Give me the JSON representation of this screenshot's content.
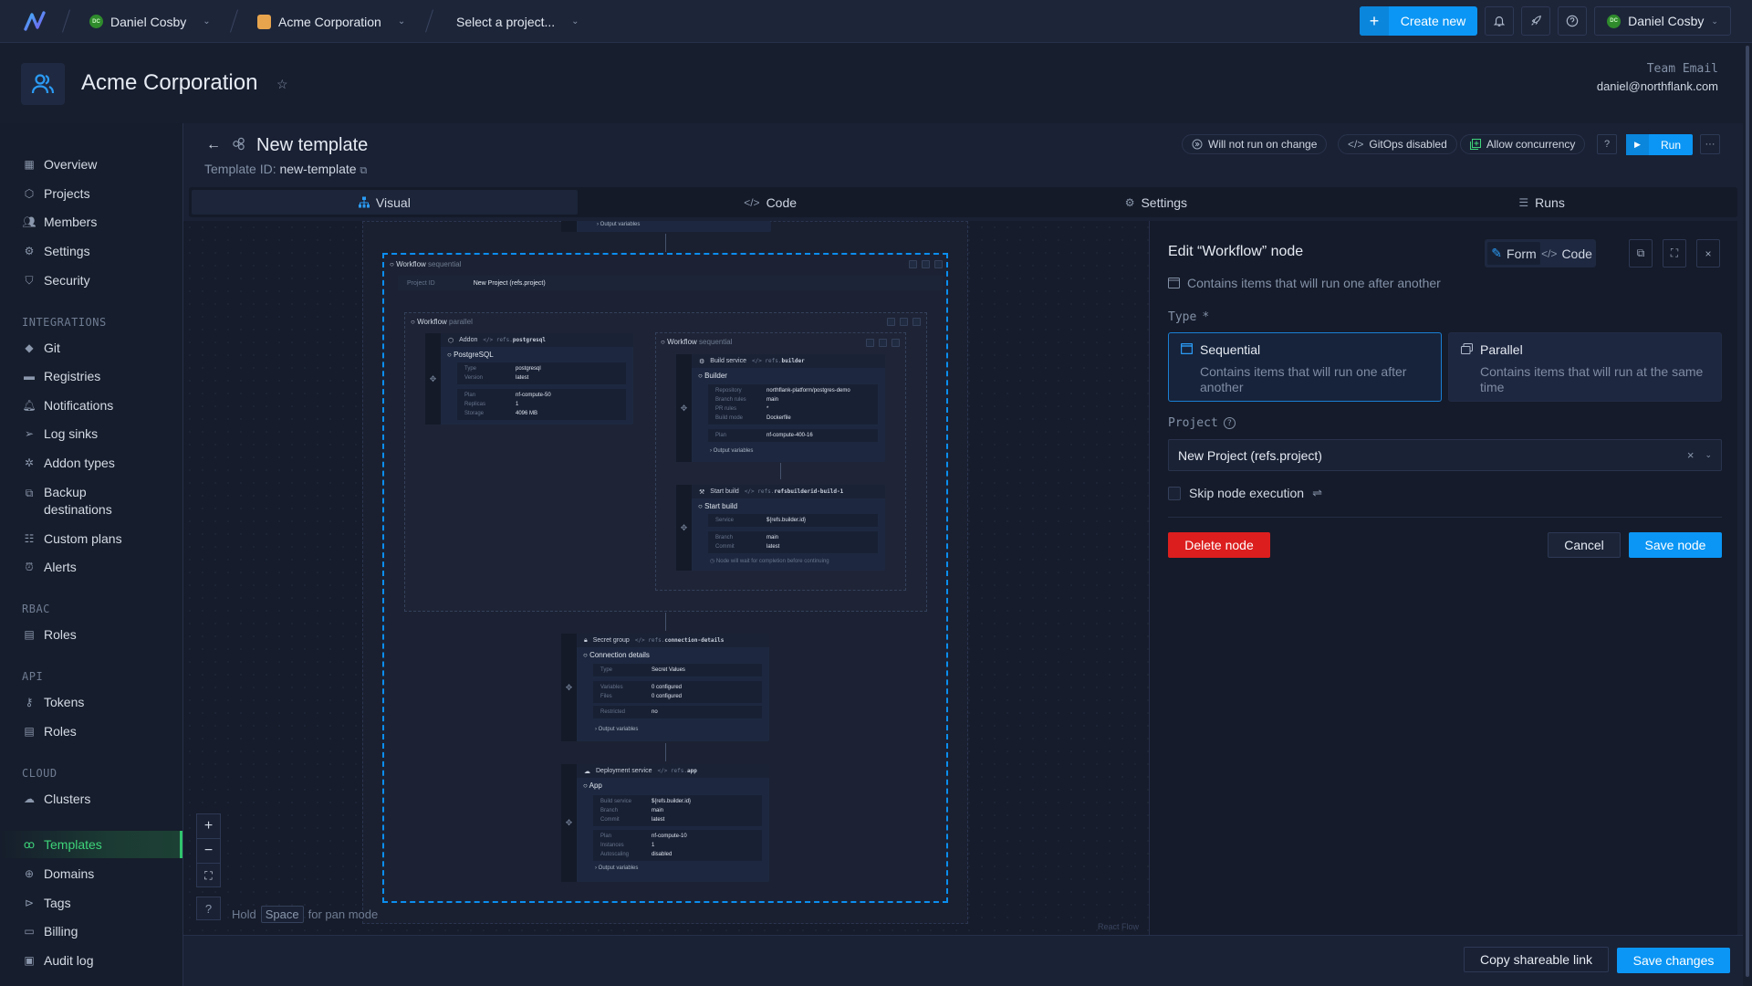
{
  "topbar": {
    "user": {
      "initials": "DC",
      "name": "Daniel Cosby"
    },
    "team": {
      "name": "Acme Corporation"
    },
    "project_select": "Select a project...",
    "create_new": "Create new",
    "account": {
      "initials": "DC",
      "name": "Daniel Cosby"
    },
    "icons": [
      "bell-icon",
      "rocket-icon",
      "help-icon"
    ]
  },
  "org": {
    "title": "Acme Corporation",
    "team_email_label": "Team Email",
    "team_email": "daniel@northflank.com"
  },
  "sidebar": {
    "items": [
      {
        "label": "Overview",
        "icon": "grid-icon"
      },
      {
        "label": "Projects",
        "icon": "cube-icon"
      },
      {
        "label": "Members",
        "icon": "users-icon"
      },
      {
        "label": "Settings",
        "icon": "gear-icon"
      },
      {
        "label": "Security",
        "icon": "shield-icon"
      }
    ],
    "sections": {
      "integrations": "INTEGRATIONS",
      "rbac": "RBAC",
      "api": "API",
      "cloud": "CLOUD"
    },
    "integrations": [
      {
        "label": "Git",
        "icon": "git-icon"
      },
      {
        "label": "Registries",
        "icon": "docker-icon"
      },
      {
        "label": "Notifications",
        "icon": "bell-icon"
      },
      {
        "label": "Log sinks",
        "icon": "send-icon"
      },
      {
        "label": "Addon types",
        "icon": "puzzle-icon"
      },
      {
        "label": "Backup destinations",
        "icon": "copy-icon"
      },
      {
        "label": "Custom plans",
        "icon": "sliders-icon"
      },
      {
        "label": "Alerts",
        "icon": "alarm-icon"
      }
    ],
    "rbac": [
      {
        "label": "Roles",
        "icon": "id-card-icon"
      }
    ],
    "api": [
      {
        "label": "Tokens",
        "icon": "key-icon"
      },
      {
        "label": "Roles",
        "icon": "id-card-icon"
      }
    ],
    "cloud": [
      {
        "label": "Clusters",
        "icon": "cloud-icon"
      }
    ],
    "bottom": [
      {
        "label": "Templates",
        "icon": "template-icon",
        "active": true
      },
      {
        "label": "Domains",
        "icon": "globe-icon"
      },
      {
        "label": "Tags",
        "icon": "tag-icon"
      },
      {
        "label": "Billing",
        "icon": "credit-card-icon"
      },
      {
        "label": "Audit log",
        "icon": "calendar-icon"
      }
    ]
  },
  "template": {
    "title": "New template",
    "id_label": "Template ID:",
    "id_value": "new-template",
    "badges": {
      "run_on_change": "Will not run on change",
      "gitops": "GitOps disabled",
      "concurrency": "Allow concurrency"
    },
    "run": "Run"
  },
  "tabs": [
    {
      "label": "Visual",
      "active": true
    },
    {
      "label": "Code"
    },
    {
      "label": "Settings"
    },
    {
      "label": "Runs"
    }
  ],
  "canvas": {
    "top_output": "Output variables",
    "root": {
      "kind": "Workflow",
      "mode": "sequential",
      "project_label": "Project ID",
      "project_value": "New Project (refs.project)"
    },
    "parallel": {
      "kind": "Workflow",
      "mode": "parallel"
    },
    "addon": {
      "type": "Addon",
      "ref_prefix": "refs.",
      "ref": "postgresql",
      "title": "PostgreSQL",
      "rows1": [
        {
          "k": "Type",
          "v": "postgresql"
        },
        {
          "k": "Version",
          "v": "latest"
        }
      ],
      "rows2": [
        {
          "k": "Plan",
          "v": "nf-compute-50"
        },
        {
          "k": "Replicas",
          "v": "1"
        },
        {
          "k": "Storage",
          "v": "4096 MB"
        }
      ]
    },
    "inner_seq": {
      "kind": "Workflow",
      "mode": "sequential"
    },
    "builder": {
      "type": "Build service",
      "ref_prefix": "refs.",
      "ref": "builder",
      "title": "Builder",
      "rows1": [
        {
          "k": "Repository",
          "v": "northflank-platform/postgres-demo"
        },
        {
          "k": "Branch rules",
          "v": "main"
        },
        {
          "k": "PR rules",
          "v": "*"
        },
        {
          "k": "Build mode",
          "v": "Dockerfile"
        }
      ],
      "rows2": [
        {
          "k": "Plan",
          "v": "nf-compute-400-16"
        }
      ],
      "output": "Output variables"
    },
    "start_build": {
      "type": "Start build",
      "ref_prefix": "refs.",
      "ref": "refsbuilderid-build-1",
      "title": "Start build",
      "rows1": [
        {
          "k": "Service",
          "v": "${refs.builder.id}"
        }
      ],
      "rows2": [
        {
          "k": "Branch",
          "v": "main"
        },
        {
          "k": "Commit",
          "v": "latest"
        }
      ],
      "note": "Node will wait for completion before continuing"
    },
    "secret": {
      "type": "Secret group",
      "ref_prefix": "refs.",
      "ref": "connection-details",
      "title": "Connection details",
      "rows1": [
        {
          "k": "Type",
          "v": "Secret Values"
        }
      ],
      "rows2": [
        {
          "k": "Variables",
          "v": "0 configured"
        },
        {
          "k": "Files",
          "v": "0 configured"
        }
      ],
      "rows3": [
        {
          "k": "Restricted",
          "v": "no"
        }
      ],
      "output": "Output variables"
    },
    "deploy": {
      "type": "Deployment service",
      "ref_prefix": "refs.",
      "ref": "app",
      "title": "App",
      "rows1": [
        {
          "k": "Build service",
          "v": "${refs.builder.id}"
        },
        {
          "k": "Branch",
          "v": "main"
        },
        {
          "k": "Commit",
          "v": "latest"
        }
      ],
      "rows2": [
        {
          "k": "Plan",
          "v": "nf-compute-10"
        },
        {
          "k": "Instances",
          "v": "1"
        },
        {
          "k": "Autoscaling",
          "v": "disabled"
        }
      ],
      "output": "Output variables"
    },
    "hint": {
      "hold": "Hold",
      "key": "Space",
      "rest": "for pan mode"
    },
    "attribution": "React Flow"
  },
  "panel": {
    "title": "Edit “Workflow” node",
    "mode_form": "Form",
    "mode_code": "Code",
    "description": "Contains items that will run one after another",
    "type_label": "Type",
    "required": "*",
    "options": [
      {
        "title": "Sequential",
        "desc": "Contains items that will run one after another",
        "selected": true
      },
      {
        "title": "Parallel",
        "desc": "Contains items that will run at the same time",
        "selected": false
      }
    ],
    "project_label": "Project",
    "project_value": "New Project (refs.project)",
    "skip_label": "Skip node execution",
    "skip_checked": false,
    "delete": "Delete node",
    "cancel": "Cancel",
    "save": "Save node"
  },
  "footer": {
    "copy_link": "Copy shareable link",
    "save_changes": "Save changes"
  },
  "colors": {
    "accent": "#0b96f5",
    "active_nav": "#3ed47a",
    "danger": "#dc1e1e",
    "background": "#171e2e"
  }
}
